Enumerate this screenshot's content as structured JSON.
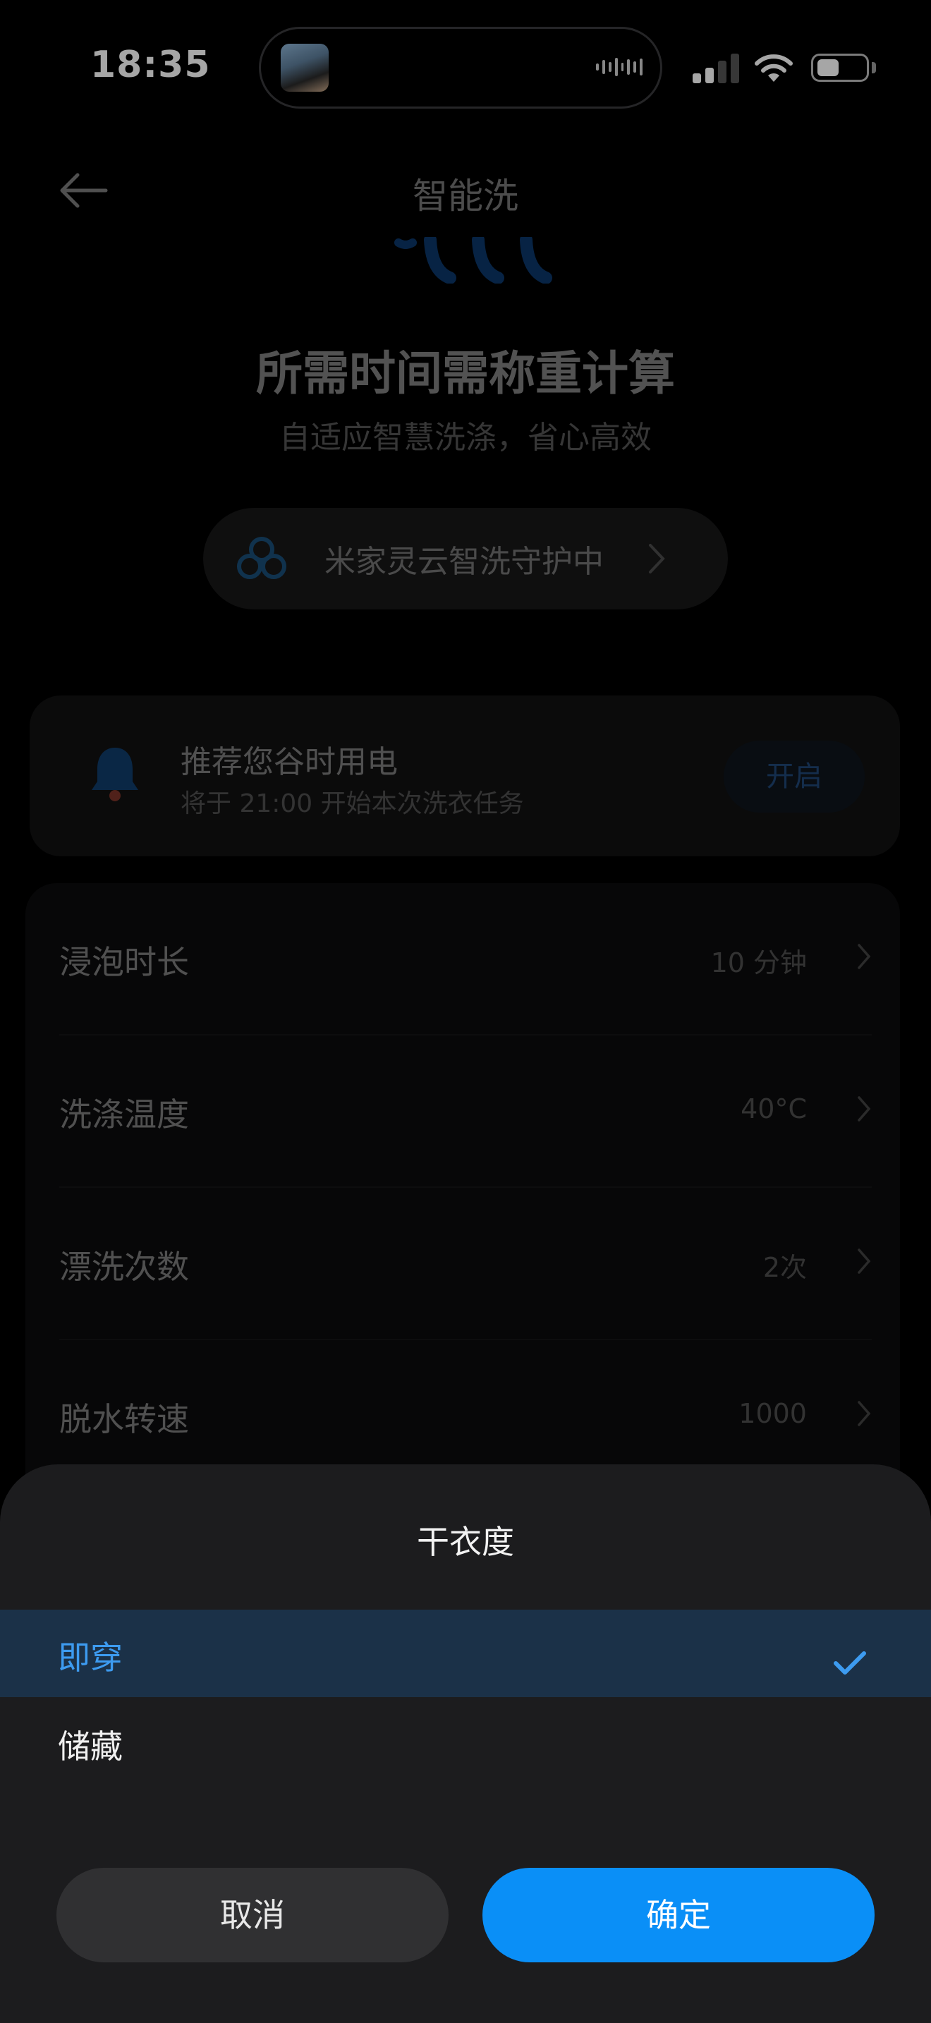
{
  "status_bar": {
    "time": "18:35"
  },
  "header": {
    "title": "智能洗",
    "back_icon": "back-arrow-icon"
  },
  "hero": {
    "title": "所需时间需称重计算",
    "subtitle": "自适应智慧洗涤，省心高效"
  },
  "cloud_banner": {
    "label": "米家灵云智洗守护中",
    "icon": "cloud-icon"
  },
  "reminder": {
    "title": "推荐您谷时用电",
    "subtitle": "将于 21:00 开始本次洗衣任务",
    "button": "开启",
    "icon": "bell-icon"
  },
  "settings": {
    "rows": [
      {
        "label": "浸泡时长",
        "value": "10 分钟"
      },
      {
        "label": "洗涤温度",
        "value": "40°C"
      },
      {
        "label": "漂洗次数",
        "value": "2次"
      },
      {
        "label": "脱水转速",
        "value": "1000"
      }
    ]
  },
  "sheet": {
    "title": "干衣度",
    "options": [
      {
        "label": "即穿",
        "selected": true
      },
      {
        "label": "储藏",
        "selected": false
      }
    ],
    "cancel": "取消",
    "confirm": "确定"
  },
  "colors": {
    "accent": "#0a8ff7",
    "selected_text": "#3d9bf0",
    "selected_bg": "#1b3148",
    "sheet_bg": "#1c1c1e"
  }
}
